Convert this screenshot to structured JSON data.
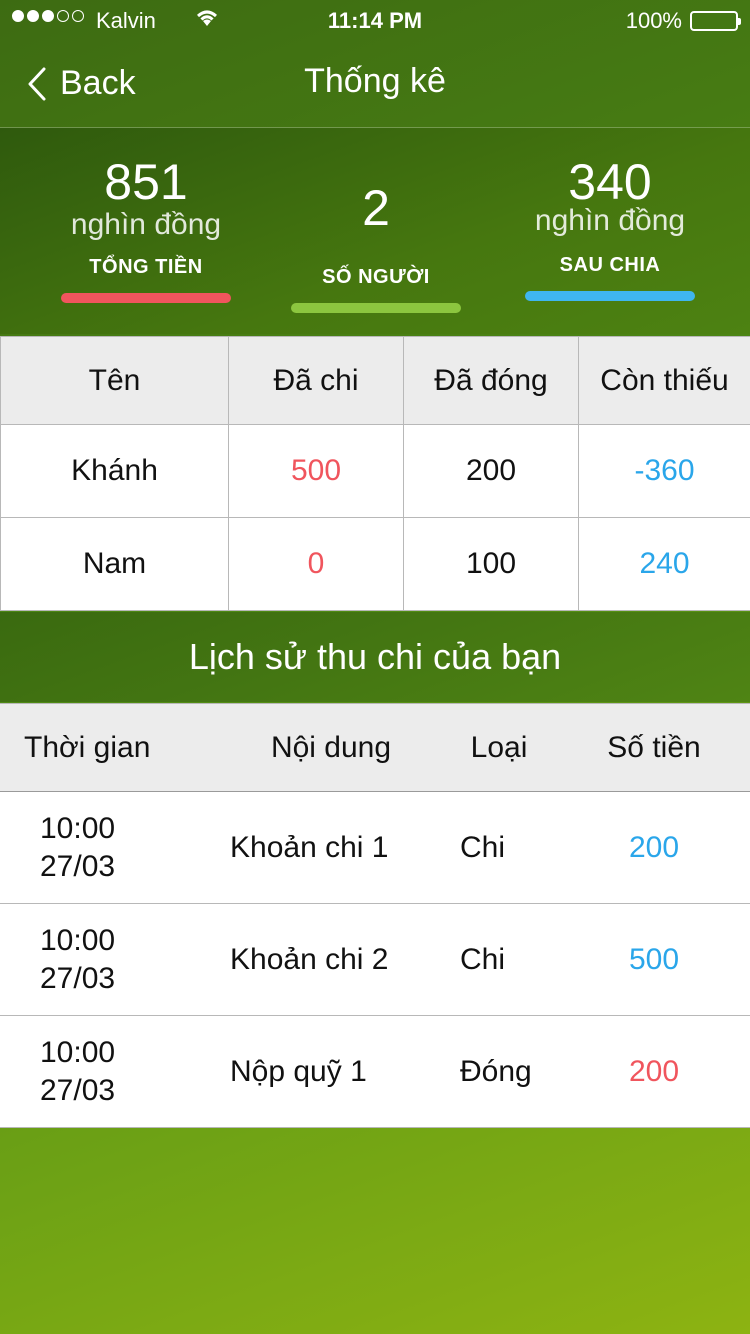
{
  "status_bar": {
    "carrier": "Kalvin",
    "time": "11:14 PM",
    "battery": "100%"
  },
  "nav": {
    "back_label": "Back",
    "title": "Thống kê"
  },
  "summary": {
    "total": {
      "value": "851",
      "unit": "nghìn đồng",
      "label": "TỔNG TIỀN",
      "color": "#f0555d"
    },
    "people": {
      "value": "2",
      "label": "SỐ NGƯỜI",
      "color": "#8cc63f"
    },
    "split": {
      "value": "340",
      "unit": "nghìn đồng",
      "label": "SAU CHIA",
      "color": "#3fb6f0"
    }
  },
  "members": {
    "headers": [
      "Tên",
      "Đã chi",
      "Đã đóng",
      "Còn thiếu"
    ],
    "rows": [
      {
        "name": "Khánh",
        "spent": "500",
        "paid": "200",
        "owed": "-360"
      },
      {
        "name": "Nam",
        "spent": "0",
        "paid": "100",
        "owed": "240"
      }
    ]
  },
  "history": {
    "title": "Lịch sử thu chi của bạn",
    "headers": [
      "Thời gian",
      "Nội dung",
      "Loại",
      "Số tiền"
    ],
    "rows": [
      {
        "time": "10:00",
        "date": "27/03",
        "content": "Khoản chi 1",
        "type": "Chi",
        "amount": "200"
      },
      {
        "time": "10:00",
        "date": "27/03",
        "content": "Khoản chi 2",
        "type": "Chi",
        "amount": "500"
      },
      {
        "time": "10:00",
        "date": "27/03",
        "content": "Nộp quỹ 1",
        "type": "Đóng",
        "amount": "200"
      }
    ]
  }
}
